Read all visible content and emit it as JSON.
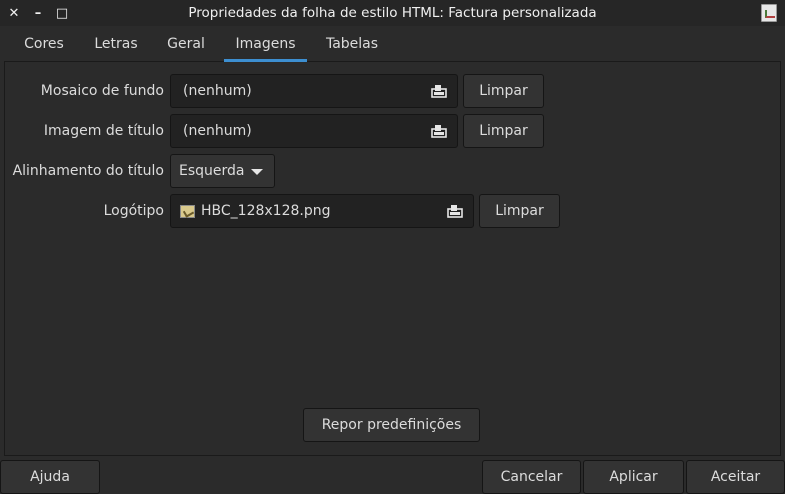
{
  "window": {
    "title": "Propriedades da folha de estilo HTML: Factura personalizada",
    "close_glyph": "✕",
    "minimize_glyph": "–",
    "maximize_glyph": "□"
  },
  "tabs": [
    {
      "label": "Cores",
      "active": false
    },
    {
      "label": "Letras",
      "active": false
    },
    {
      "label": "Geral",
      "active": false
    },
    {
      "label": "Imagens",
      "active": true
    },
    {
      "label": "Tabelas",
      "active": false
    }
  ],
  "form": {
    "background_tile": {
      "label": "Mosaico de fundo",
      "value": "(nenhum)",
      "clear_label": "Limpar"
    },
    "heading_image": {
      "label": "Imagem de título",
      "value": "(nenhum)",
      "clear_label": "Limpar"
    },
    "heading_alignment": {
      "label": "Alinhamento do título",
      "value": "Esquerda"
    },
    "logo": {
      "label": "Logótipo",
      "value": "HBC_128x128.png",
      "clear_label": "Limpar"
    }
  },
  "reset_label": "Repor predefinições",
  "footer": {
    "help_label": "Ajuda",
    "cancel_label": "Cancelar",
    "apply_label": "Aplicar",
    "ok_label": "Aceitar"
  },
  "colors": {
    "accent": "#3d8fd1",
    "background": "#2b2b2b"
  },
  "icons": {
    "file_chooser": "file-chooser-icon",
    "image_file": "image-file-icon",
    "dropdown": "chevron-down-icon"
  }
}
